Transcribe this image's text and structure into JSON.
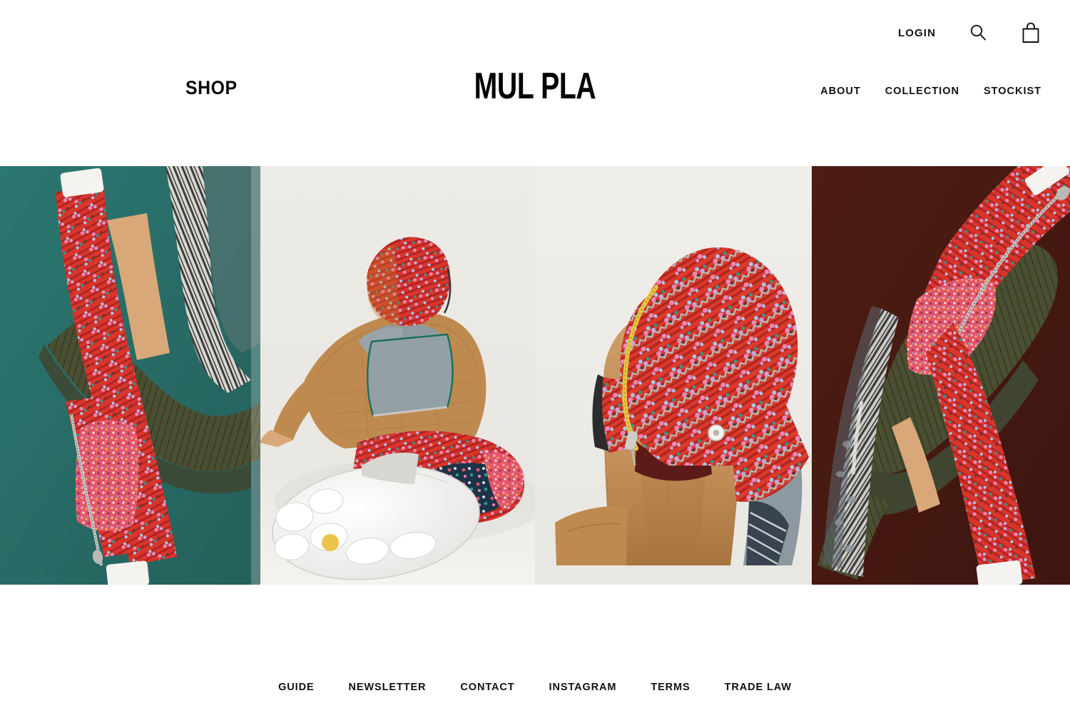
{
  "header": {
    "brand": "MUL PLA",
    "shop_label": "SHOP",
    "login_label": "LOGIN",
    "search_icon": "search-icon",
    "cart_icon": "shopping-bag-icon",
    "nav": [
      {
        "label": "ABOUT"
      },
      {
        "label": "COLLECTION"
      },
      {
        "label": "STOCKIST"
      }
    ]
  },
  "hero": {
    "panels": [
      {
        "name": "panel-teal-floral-trousers",
        "background_color": "#2a726c",
        "alt": "Model in red floral print garment with olive pleated fabric and zebra-stripe textile on teal background"
      },
      {
        "name": "panel-studio-lying-model",
        "background_color": "#eeece8",
        "alt": "Model lying down in tan quilted jacket with grey fleece panel, red floral hood and white chunky boot sole"
      },
      {
        "name": "panel-portrait-floral-hood",
        "background_color": "#efedea",
        "alt": "Blonde model wearing red floral hood with yellow zipper covering the eyes"
      },
      {
        "name": "panel-maroon-floral-trousers",
        "background_color": "#4a1b12",
        "alt": "Model in red floral print garment with olive pleats and zebra textile on dark maroon background"
      }
    ]
  },
  "footer": {
    "nav": [
      {
        "label": "GUIDE"
      },
      {
        "label": "NEWSLETTER"
      },
      {
        "label": "CONTACT"
      },
      {
        "label": "INSTAGRAM"
      },
      {
        "label": "TERMS"
      },
      {
        "label": "TRADE LAW"
      }
    ]
  },
  "colors": {
    "page_background": "#ffffff",
    "text": "#111111",
    "panel_teal": "#2a726c",
    "panel_offwhite": "#eeece8",
    "panel_maroon": "#4a1b12",
    "floral_red": "#d8352c",
    "olive": "#4a4f32",
    "camel": "#bf8a4f",
    "fleece_grey": "#8f9aa0",
    "sole_yellow": "#ecc44b",
    "hair_blonde": "#c99a62"
  }
}
